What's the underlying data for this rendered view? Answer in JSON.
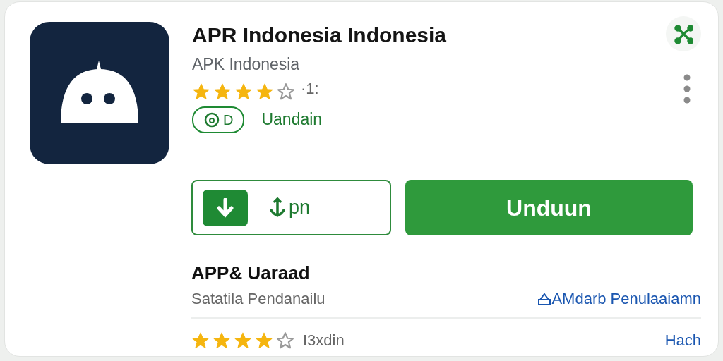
{
  "app": {
    "title": "APR Indonesia Indonesia",
    "developer": "APK Indonesia",
    "stars": 4,
    "rating_text": "·1:",
    "badge": "D",
    "badge_label": "Uandain"
  },
  "buttons": [
    {
      "kind": "outline",
      "label": "pn"
    },
    {
      "kind": "primary",
      "label": "Unduun"
    }
  ],
  "section": {
    "title": "APP& Uaraad",
    "subtitle": "Satatila Pendanailu",
    "link": "AMdarb Penulaaiamn"
  },
  "review": {
    "stars": 4,
    "text": "I3xdin",
    "link": "Hach"
  }
}
